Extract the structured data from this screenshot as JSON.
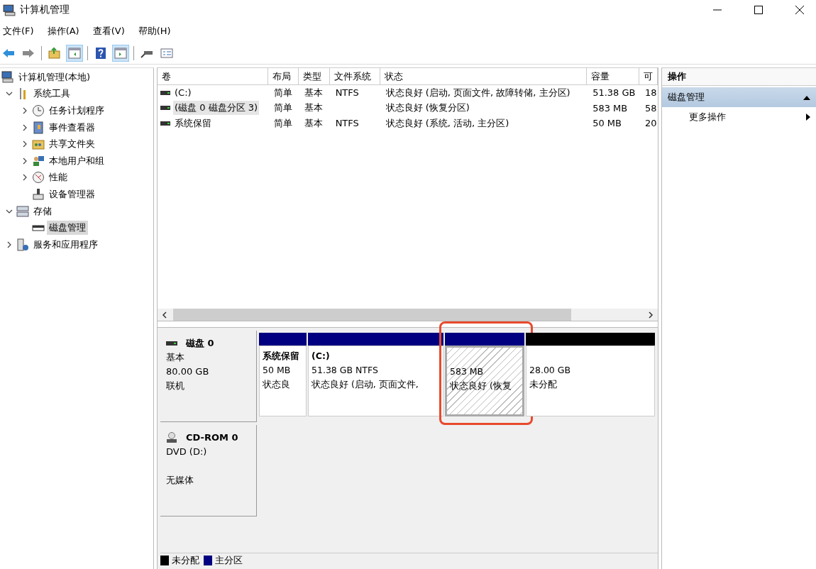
{
  "window": {
    "title": "计算机管理"
  },
  "menu": [
    "文件(F)",
    "操作(A)",
    "查看(V)",
    "帮助(H)"
  ],
  "toolbar": [
    {
      "kind": "back",
      "pressed": false
    },
    {
      "kind": "forward",
      "pressed": false
    },
    {
      "kind": "sep"
    },
    {
      "kind": "up",
      "pressed": false
    },
    {
      "kind": "tree",
      "pressed": true
    },
    {
      "kind": "sep"
    },
    {
      "kind": "help",
      "pressed": false
    },
    {
      "kind": "pane",
      "pressed": true
    },
    {
      "kind": "sep"
    },
    {
      "kind": "connect",
      "pressed": false
    },
    {
      "kind": "props",
      "pressed": false
    }
  ],
  "tree": [
    {
      "label": "计算机管理(本地)",
      "kind": "computer",
      "selected": false,
      "children": [
        {
          "label": "系统工具",
          "kind": "tools",
          "selected": false,
          "expanded": true,
          "children": [
            {
              "label": "任务计划程序",
              "kind": "clock",
              "selected": false,
              "expanded": false
            },
            {
              "label": "事件查看器",
              "kind": "book",
              "selected": false,
              "expanded": false
            },
            {
              "label": "共享文件夹",
              "kind": "folder",
              "selected": false,
              "expanded": false
            },
            {
              "label": "本地用户和组",
              "kind": "users",
              "selected": false,
              "expanded": false
            },
            {
              "label": "性能",
              "kind": "gauge",
              "selected": false,
              "expanded": false
            },
            {
              "label": "设备管理器",
              "kind": "device",
              "selected": false
            }
          ]
        },
        {
          "label": "存储",
          "kind": "storage",
          "selected": false,
          "expanded": true,
          "children": [
            {
              "label": "磁盘管理",
              "kind": "disk",
              "selected": true
            }
          ]
        },
        {
          "label": "服务和应用程序",
          "kind": "server",
          "selected": false,
          "expanded": false
        }
      ]
    }
  ],
  "table": {
    "columns": [
      "卷",
      "布局",
      "类型",
      "文件系统",
      "状态",
      "容量",
      "可"
    ],
    "rows": [
      {
        "selected": false,
        "cells": [
          "(C:)",
          "简单",
          "基本",
          "NTFS",
          "状态良好 (启动, 页面文件, 故障转储, 主分区)",
          "51.38 GB",
          "18"
        ]
      },
      {
        "selected": true,
        "cells": [
          "(磁盘 0 磁盘分区 3)",
          "简单",
          "基本",
          "",
          "状态良好 (恢复分区)",
          "583 MB",
          "58"
        ]
      },
      {
        "selected": false,
        "cells": [
          "系统保留",
          "简单",
          "基本",
          "NTFS",
          "状态良好 (系统, 活动, 主分区)",
          "50 MB",
          "20"
        ]
      }
    ]
  },
  "disks": [
    {
      "kind": "disk",
      "name": "磁盘 0",
      "type": "基本",
      "size": "80.00 GB",
      "status": "联机",
      "partitions": [
        {
          "name": "系统保留",
          "size": "50 MB",
          "status": "状态良",
          "color": "#000080",
          "selected": false,
          "highlighted": false
        },
        {
          "name": "(C:)",
          "size": "51.38 GB NTFS",
          "status": "状态良好 (启动, 页面文件,",
          "color": "#000080",
          "selected": false,
          "highlighted": false
        },
        {
          "size": "583 MB",
          "status": "状态良好 (恢复",
          "color": "#000080",
          "selected": true,
          "highlighted": true
        },
        {
          "size": "28.00 GB",
          "status": "未分配",
          "color": "#000000",
          "selected": false,
          "highlighted": false
        }
      ]
    },
    {
      "kind": "cdrom",
      "name": "CD-ROM 0",
      "type": "DVD (D:)",
      "status": "无媒体"
    }
  ],
  "legend": [
    {
      "label": "未分配",
      "color": "#000000"
    },
    {
      "label": "主分区",
      "color": "#000080"
    }
  ],
  "actions": {
    "title": "操作",
    "section": {
      "label": "磁盘管理",
      "expanded": true
    },
    "items": [
      "更多操作"
    ]
  }
}
